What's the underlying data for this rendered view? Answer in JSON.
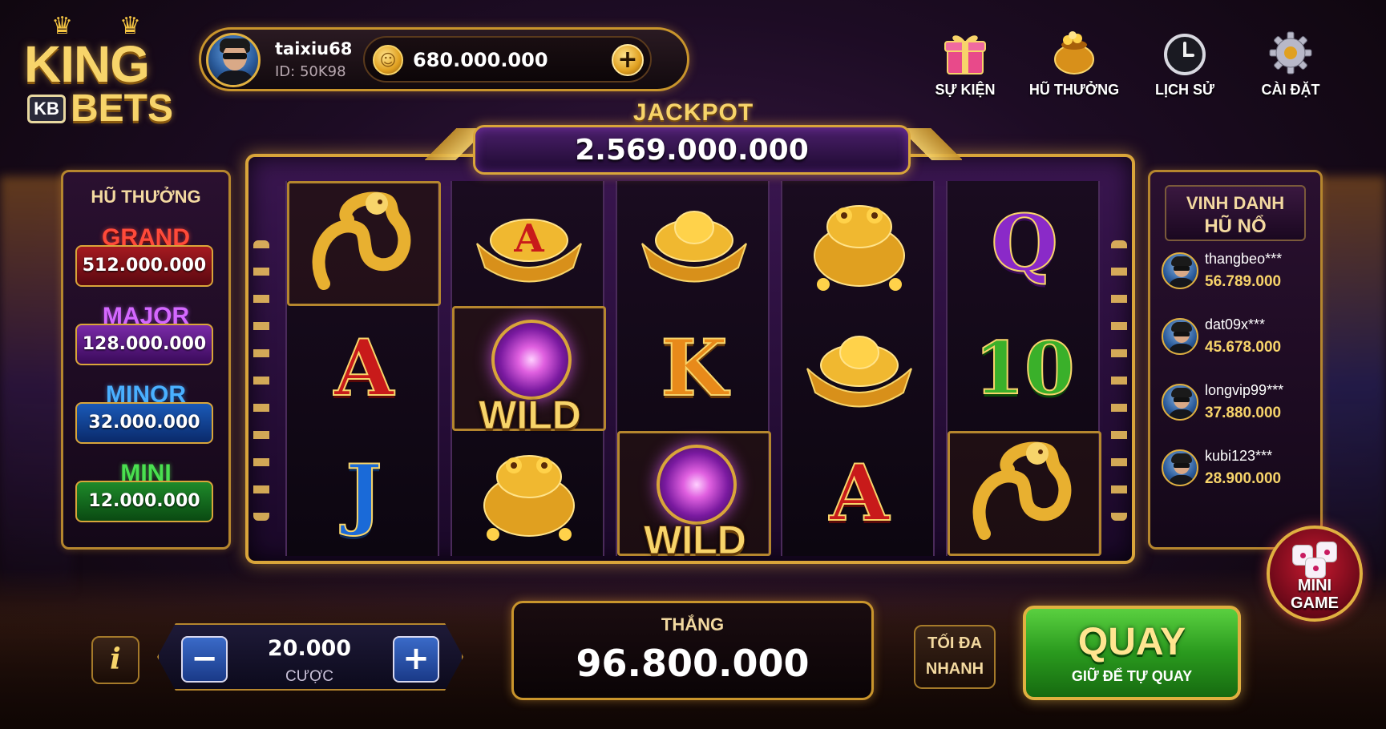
{
  "logo": {
    "king": "KING",
    "kb": "KB",
    "bets": "BETS"
  },
  "player": {
    "name": "taixiu68",
    "id": "ID: 50K98",
    "balance": "680.000.000"
  },
  "top_menu": [
    {
      "label": "SỰ KIỆN",
      "icon": "gift-icon"
    },
    {
      "label": "HŨ THƯỞNG",
      "icon": "pot-icon"
    },
    {
      "label": "LỊCH SỬ",
      "icon": "clock-icon"
    },
    {
      "label": "CÀI ĐẶT",
      "icon": "gear-icon"
    }
  ],
  "jackpot": {
    "title": "JACKPOT",
    "value": "2.569.000.000"
  },
  "tiers": {
    "title": "HŨ THƯỞNG",
    "grand": {
      "name": "GRAND",
      "value": "512.000.000"
    },
    "major": {
      "name": "MAJOR",
      "value": "128.000.000"
    },
    "minor": {
      "name": "MINOR",
      "value": "32.000.000"
    },
    "mini": {
      "name": "MINI",
      "value": "12.000.000"
    }
  },
  "reels": [
    [
      "dragon",
      "A",
      "J"
    ],
    [
      "ingot-a",
      "WILD",
      "toad"
    ],
    [
      "ingot",
      "K",
      "WILD"
    ],
    [
      "toad",
      "ingot",
      "A"
    ],
    [
      "Q",
      "10",
      "dragon"
    ]
  ],
  "wild_label": "WILD",
  "winners": {
    "title1": "VINH DANH",
    "title2": "HŨ NỔ",
    "list": [
      {
        "name": "thangbeo***",
        "amount": "56.789.000"
      },
      {
        "name": "dat09x***",
        "amount": "45.678.000"
      },
      {
        "name": "longvip99***",
        "amount": "37.880.000"
      },
      {
        "name": "kubi123***",
        "amount": "28.900.000"
      }
    ]
  },
  "mini_game": {
    "line1": "MINI",
    "line2": "GAME"
  },
  "bet": {
    "value": "20.000",
    "label": "CƯỢC",
    "minus": "−",
    "plus": "+"
  },
  "info": {
    "label": "i"
  },
  "win": {
    "label": "THẮNG",
    "value": "96.800.000"
  },
  "turbo": {
    "line1": "TỐI ĐA",
    "line2": "NHANH"
  },
  "spin": {
    "label": "QUAY",
    "sub": "GIỮ ĐỂ TỰ QUAY"
  },
  "colors": {
    "gold": "#d9a53a",
    "spin_green": "#2a9a1e",
    "jackpot_purple": "#4a1f6a"
  }
}
